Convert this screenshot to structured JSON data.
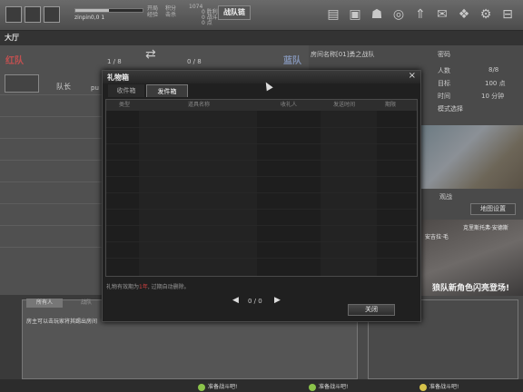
{
  "top_bar": {
    "player_name": "zinpin0,0 1",
    "stats": [
      "开局",
      "经验",
      "积分",
      "击杀"
    ],
    "gold": "1074",
    "points": [
      "0 胜利",
      "0 战斗",
      "0 点"
    ],
    "team_tab": "战队链"
  },
  "hall": "大厅",
  "room": {
    "red_team": "红队",
    "blue_team": "蓝队",
    "red_count": "1 / 8",
    "blue_count": "0 / 8",
    "player_name": "队长",
    "player_tag": "pu"
  },
  "room_info": {
    "room_name": "房间名称[01]勇之战队",
    "password_label": "密码",
    "people_label": "人数",
    "people_value": "8/8",
    "target_label": "目标",
    "target_value": "100 点",
    "time_label": "时间",
    "time_value": "10 分钟",
    "mode_label": "模式选择",
    "watch_label": "观战",
    "map_settings": "地图设置",
    "ad_caption1": "克里斯托弗·安德斯",
    "ad_caption2": "安吉拉·毛",
    "ad_title": "狼队新角色闪亮登场!"
  },
  "chat": {
    "tab_all": "所有人",
    "tab_team": "战队",
    "message": "房主可以击玩家将其踢出房间"
  },
  "bottom": {
    "ready_1": "准备战斗吧!",
    "ready_2": "准备战斗吧!",
    "ready_3": "准备战斗吧!"
  },
  "dialog": {
    "title": "礼物箱",
    "close_x": "×",
    "tab_inbox": "收件箱",
    "tab_sent": "发件箱",
    "columns": [
      "类型",
      "道具名称",
      "收礼人",
      "发送时间",
      "期限"
    ],
    "notice_prefix": "礼物有效期为",
    "notice_highlight": "1年",
    "notice_suffix": ", 过期自动删除。",
    "pager_prev": "◀",
    "pager_page": "0 / 0",
    "pager_next": "▶",
    "close_button": "关闭"
  }
}
